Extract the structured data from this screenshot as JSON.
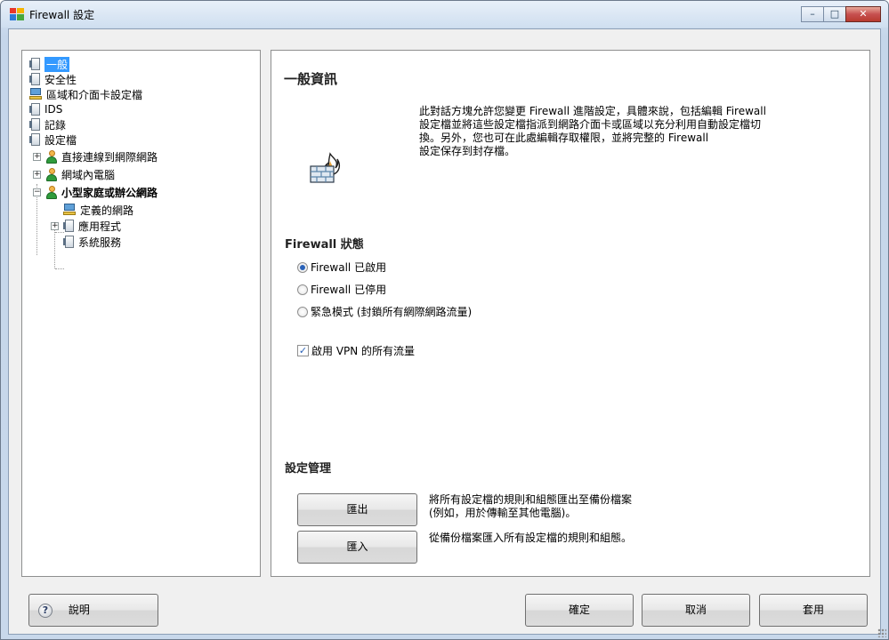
{
  "window": {
    "title": "Firewall 設定",
    "controls": {
      "minimize": "–",
      "maximize": "□",
      "close": "✕"
    }
  },
  "tree": {
    "items": [
      {
        "label": "一般",
        "icon": "document-icon",
        "selected": true
      },
      {
        "label": "安全性",
        "icon": "document-icon"
      },
      {
        "label": "區域和介面卡設定檔",
        "icon": "network-icon"
      },
      {
        "label": "IDS",
        "icon": "document-icon"
      },
      {
        "label": "記錄",
        "icon": "document-icon"
      },
      {
        "label": "設定檔",
        "icon": "document-icon"
      },
      {
        "label": "直接連線到網際網路",
        "icon": "user-icon",
        "expander": "+"
      },
      {
        "label": "網域內電腦",
        "icon": "user-icon",
        "expander": "+"
      },
      {
        "label": "小型家庭或辦公網路",
        "icon": "user-icon",
        "expander": "−",
        "bold": true
      },
      {
        "label": "定義的網路",
        "icon": "network-icon"
      },
      {
        "label": "應用程式",
        "icon": "document-icon",
        "expander": "+"
      },
      {
        "label": "系統服務",
        "icon": "document-icon"
      }
    ]
  },
  "panel": {
    "heading": "一般資訊",
    "description": [
      "此對話方塊允許您變更 Firewall 進階設定，具體來說，包括編輯 Firewall",
      "設定檔並將這些設定檔指派到網路介面卡或區域以充分利用自動設定檔切",
      "換。另外，您也可在此處編輯存取權限，並將完整的 Firewall",
      "設定保存到封存檔。"
    ],
    "status_heading": "Firewall 狀態",
    "status_options": [
      {
        "label": "Firewall 已啟用",
        "selected": true
      },
      {
        "label": "Firewall 已停用",
        "selected": false
      },
      {
        "label": "緊急模式 (封鎖所有網際網路流量)",
        "selected": false
      }
    ],
    "vpn_checkbox": {
      "label": "啟用 VPN 的所有流量",
      "checked": true
    },
    "management_heading": "設定管理",
    "export_button": "匯出",
    "export_desc": [
      "將所有設定檔的規則和組態匯出至備份檔案",
      "(例如，用於傳輸至其他電腦)。"
    ],
    "import_button": "匯入",
    "import_desc": "從備份檔案匯入所有設定檔的規則和組態。"
  },
  "footer": {
    "help_button": "說明",
    "ok_button": "確定",
    "cancel_button": "取消",
    "apply_button": "套用"
  }
}
